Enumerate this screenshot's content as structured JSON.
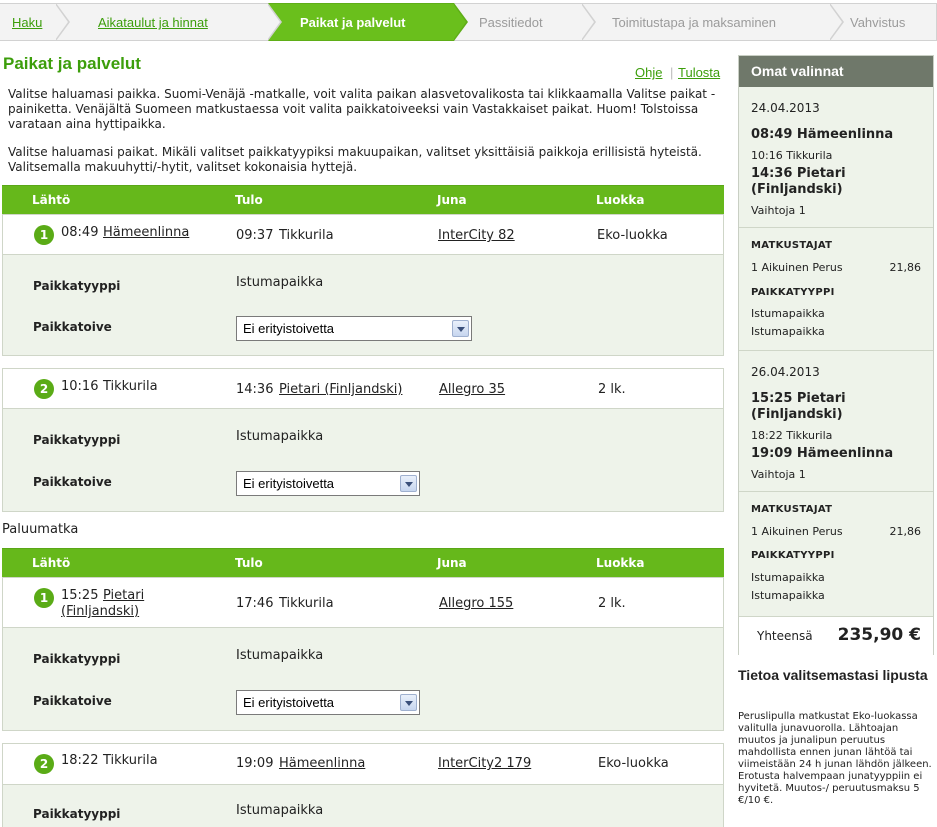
{
  "steps": [
    {
      "label": "Haku",
      "state": "done"
    },
    {
      "label": "Aikataulut ja hinnat",
      "state": "done"
    },
    {
      "label": "Paikat ja palvelut",
      "state": "active"
    },
    {
      "label": "Passitiedot",
      "state": "todo"
    },
    {
      "label": "Toimitustapa ja maksaminen",
      "state": "todo"
    },
    {
      "label": "Vahvistus",
      "state": "todo"
    }
  ],
  "page": {
    "title": "Paikat ja palvelut",
    "help_link": "Ohje",
    "separator": "|",
    "print_link": "Tulosta",
    "intro1": "Valitse haluamasi paikka. Suomi-Venäjä -matkalle, voit valita paikan alasvetovalikosta tai klikkaamalla Valitse paikat -painiketta. Venäjältä Suomeen matkustaessa voit valita paikkatoiveeksi vain Vastakkaiset paikat. Huom! Tolstoissa varataan aina hyttipaikka.",
    "intro2": "Valitse haluamasi paikat. Mikäli valitset paikkatyypiksi makuupaikan, valitset yksittäisiä paikkoja erillisistä hyteistä. Valitsemalla makuuhytti/-hytit, valitset kokonaisia hyttejä.",
    "return_label": "Paluumatka"
  },
  "table": {
    "col_departure": "Lähtö",
    "col_arrival": "Tulo",
    "col_train": "Juna",
    "col_class": "Luokka"
  },
  "labels": {
    "seat_type": "Paikkatyyppi",
    "seat_pref": "Paikkatoive"
  },
  "outbound": [
    {
      "num": "1",
      "dep_time": "08:49",
      "dep_station": "Hämeenlinna",
      "arr_time": "09:37",
      "arr_station": "Tikkurila",
      "train": "InterCity 82",
      "class": "Eko-luokka",
      "seat_type": "Istumapaikka",
      "seat_pref": "Ei erityistoivetta"
    },
    {
      "num": "2",
      "dep_time": "10:16",
      "dep_station": "Tikkurila",
      "arr_time": "14:36",
      "arr_station": "Pietari (Finljandski)",
      "train": "Allegro 35",
      "class": "2 lk.",
      "seat_type": "Istumapaikka",
      "seat_pref": "Ei erityistoivetta"
    }
  ],
  "return": [
    {
      "num": "1",
      "dep_time": "15:25",
      "dep_station_line1": "Pietari",
      "dep_station_line2": "(Finljandski)",
      "arr_time": "17:46",
      "arr_station": "Tikkurila",
      "train": "Allegro 155",
      "class": "2 lk.",
      "seat_type": "Istumapaikka",
      "seat_pref": "Ei erityistoivetta"
    },
    {
      "num": "2",
      "dep_time": "18:22",
      "dep_station": "Tikkurila",
      "arr_time": "19:09",
      "arr_station": "Hämeenlinna",
      "train": "InterCity2 179",
      "class": "Eko-luokka",
      "seat_type": "Istumapaikka"
    }
  ],
  "sidebar": {
    "title": "Omat valinnat",
    "trip1": {
      "date": "24.04.2013",
      "dep": "08:49 Hämeenlinna",
      "via": "10:16 Tikkurila",
      "arr_line1": "14:36 Pietari",
      "arr_line2": "(Finljandski)",
      "changes": "Vaihtoja 1"
    },
    "trip2": {
      "date": "26.04.2013",
      "dep_line1": "15:25 Pietari",
      "dep_line2": "(Finljandski)",
      "via": "18:22 Tikkurila",
      "arr": "19:09 Hämeenlinna",
      "changes": "Vaihtoja 1"
    },
    "passengers_cap": "MATKUSTAJAT",
    "passenger": "1 Aikuinen Perus",
    "passenger_price": "21,86",
    "seattype_cap": "PAIKKATYYPPI",
    "seattype_1": "Istumapaikka",
    "seattype_2": "Istumapaikka",
    "total_label": "Yhteensä",
    "total": "235,90 €"
  },
  "info": {
    "title": "Tietoa valitsemastasi lipusta",
    "text": "Peruslipulla matkustat Eko-luokassa valitulla junavuorolla. Lähtoajan muutos ja junalipun peruutus mahdollista ennen junan lähtöä tai viimeistään 24 h junan lähdön jälkeen. Erotusta halvempaan junatyyppiin ei hyvitetä. Muutos-/ peruutusmaksu 5 €/10 €."
  },
  "colors": {
    "brand_green": "#66b81b",
    "link_green": "#3c9e0b",
    "sidebar_header": "#6f786a",
    "panel_bg": "#eef3ea"
  }
}
